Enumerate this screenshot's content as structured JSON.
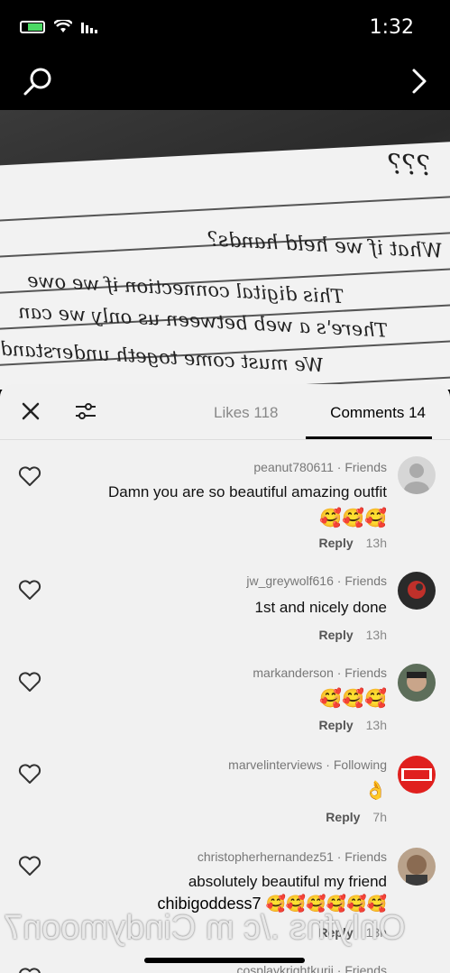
{
  "status": {
    "time": "1:32"
  },
  "nav": {
    "search_icon": "search-icon",
    "next_icon": "chevron-right-icon"
  },
  "photo": {
    "lines": [
      "???",
      "What if we held hands?",
      "This digital connection if we owe",
      "There's a web between us only we can",
      "We must come togeth understand"
    ]
  },
  "sheet": {
    "tabs": {
      "comments": "Comments 14",
      "likes": "Likes 118"
    }
  },
  "comments": [
    {
      "user": "peanut780611 · Friends",
      "text": "Damn you are so beautiful amazing outfit",
      "emoji": "🥰🥰🥰",
      "time": "13h",
      "reply": "Reply"
    },
    {
      "user": "jw_greywolf616 · Friends",
      "text": "1st and nicely done",
      "emoji": "",
      "time": "13h",
      "reply": "Reply"
    },
    {
      "user": "markanderson · Friends",
      "text": "",
      "emoji": "🥰🥰🥰",
      "time": "13h",
      "reply": "Reply"
    },
    {
      "user": "marvelinterviews · Following",
      "text": "",
      "emoji": "👌",
      "time": "7h",
      "reply": "Reply"
    },
    {
      "user": "christopherhernandez51 · Friends",
      "text": "absolutely beautiful my friend",
      "emoji": "chibigoddess7 🥰🥰🥰🥰🥰🥰",
      "time": "13h",
      "reply": "Reply"
    },
    {
      "user": "cosplaykrightkurij · Friends",
      "text": "",
      "emoji": "",
      "time": "",
      "reply": ""
    }
  ],
  "watermark": "Onlyfns ./c m Cindymoon7"
}
